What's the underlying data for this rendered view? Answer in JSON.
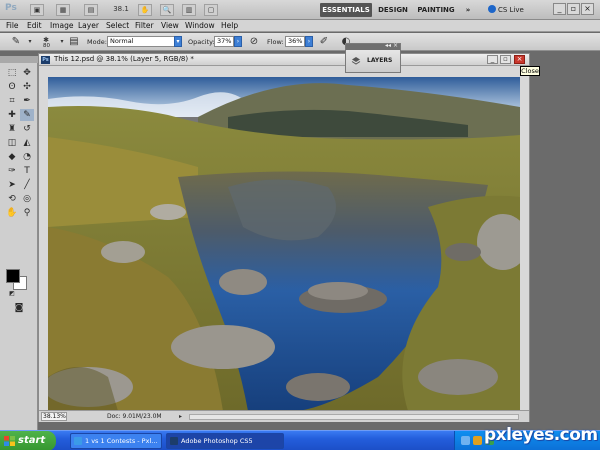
{
  "appbar": {
    "logo": "Ps",
    "zoom_value": "38.1",
    "workspaces": [
      "ESSENTIALS",
      "DESIGN",
      "PAINTING"
    ],
    "more": "»",
    "cslive": "CS Live"
  },
  "menu": [
    "File",
    "Edit",
    "Image",
    "Layer",
    "Select",
    "Filter",
    "View",
    "Window",
    "Help"
  ],
  "options": {
    "brush_size": "80",
    "mode_label": "Mode:",
    "mode_value": "Normal",
    "opacity_label": "Opacity:",
    "opacity_value": "37%",
    "flow_label": "Flow:",
    "flow_value": "36%"
  },
  "document": {
    "title": "This 12.psd @ 38.1% (Layer 5, RGB/8) *",
    "zoom_status": "38.13%",
    "doc_size": "Doc: 9.01M/23.0M"
  },
  "layers_panel": {
    "label": "LAYERS"
  },
  "tooltip": "Close",
  "taskbar": {
    "start": "start",
    "items": [
      "1 vs 1 Contests - Pxl...",
      "Adobe Photoshop CS5"
    ]
  },
  "watermark": "pxleyes.com",
  "colors": {
    "workspace_active": "#555555",
    "taskbar_blue": "#245edc",
    "start_green": "#35962f",
    "close_red": "#c9372c"
  }
}
